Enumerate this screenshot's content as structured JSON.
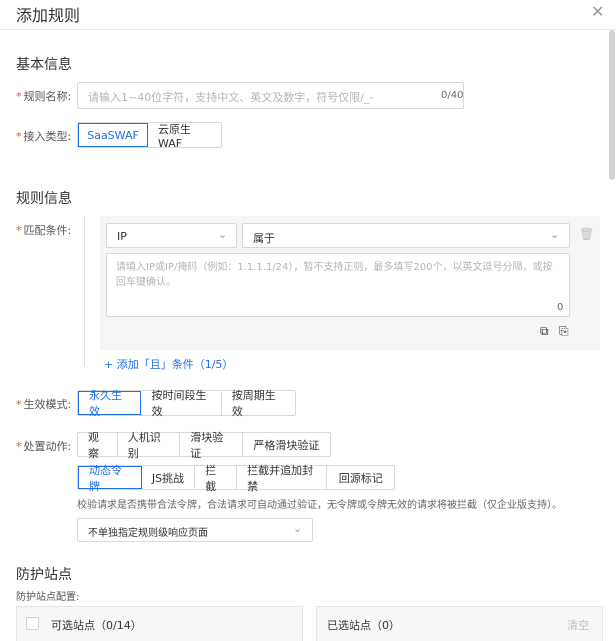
{
  "dialog": {
    "title": "添加规则",
    "close_icon": "close-icon"
  },
  "basic": {
    "section_title": "基本信息",
    "name_label": "规则名称:",
    "name_placeholder": "请输入1~40位字符，支持中文、英文及数字，符号仅限/_-",
    "name_count": "0/40",
    "type_label": "接入类型:",
    "types": [
      "SaaSWAF",
      "云原生WAF"
    ],
    "selected_type": "SaaSWAF"
  },
  "rule": {
    "section_title": "规则信息",
    "match_label": "匹配条件:",
    "field_select": "IP",
    "operator_select": "属于",
    "value_placeholder": "请填入IP或IP/掩码（例如：1.1.1.1/24），暂不支持正则，最多填写200个，以英文逗号分隔，或按回车键确认。",
    "value_count": "0",
    "add_condition": "+ 添加「且」条件（1/5）",
    "effect_label": "生效模式:",
    "effect_modes": [
      "永久生效",
      "按时间段生效",
      "按周期生效"
    ],
    "selected_effect": "永久生效",
    "action_label": "处置动作:",
    "actions_row1": [
      "观察",
      "人机识别",
      "滑块验证",
      "严格滑块验证"
    ],
    "actions_row2": [
      "动态令牌",
      "JS挑战",
      "拦截",
      "拦截并追加封禁",
      "回源标记"
    ],
    "selected_action": "动态令牌",
    "action_desc": "校验请求是否携带合法令牌，合法请求可自动通过验证，无令牌或令牌无效的请求将被拦截（仅企业版支持）。",
    "response_select": "不单独指定规则级响应页面"
  },
  "sites": {
    "section_title": "防护站点",
    "config_label": "防护站点配置:",
    "available_label": "可选站点（0/14）",
    "selected_label": "已选站点（0）",
    "clear": "清空"
  }
}
